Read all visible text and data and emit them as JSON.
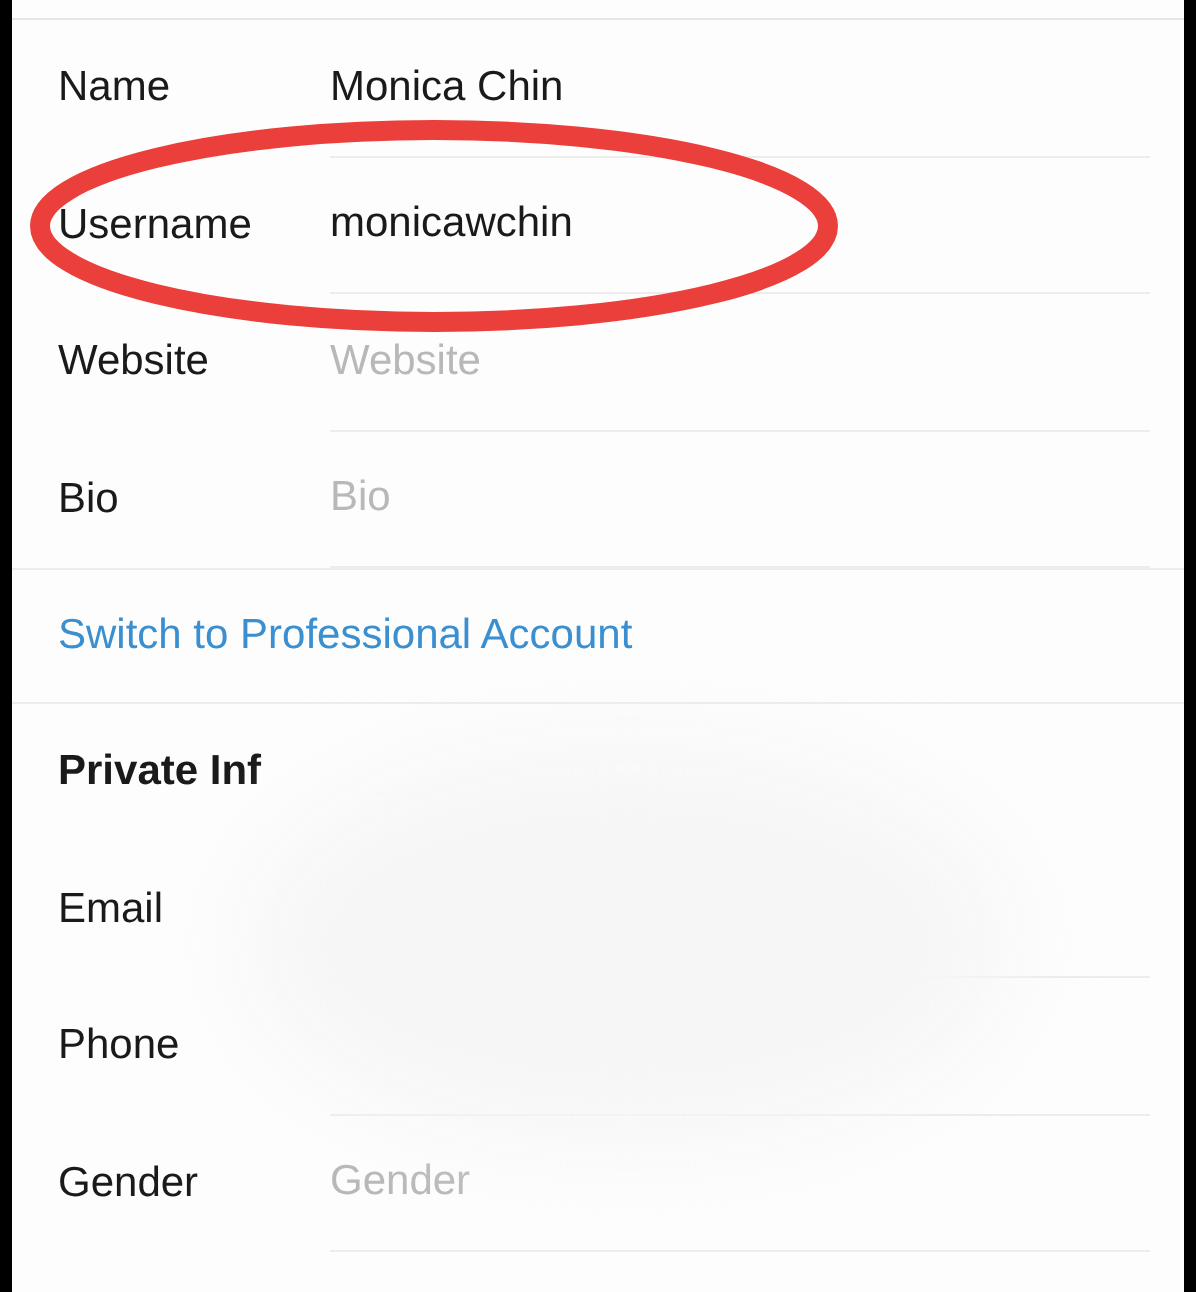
{
  "profile_fields": [
    {
      "label": "Name",
      "value": "Monica Chin"
    },
    {
      "label": "Username",
      "value": "monicawchin"
    },
    {
      "label": "Website",
      "placeholder": "Website"
    },
    {
      "label": "Bio",
      "placeholder": "Bio"
    }
  ],
  "switch_link": "Switch to Professional Account",
  "private_section": {
    "title": "Private Inf",
    "fields": [
      {
        "label": "Email"
      },
      {
        "label": "Phone"
      },
      {
        "label": "Gender",
        "placeholder": "Gender"
      }
    ]
  }
}
